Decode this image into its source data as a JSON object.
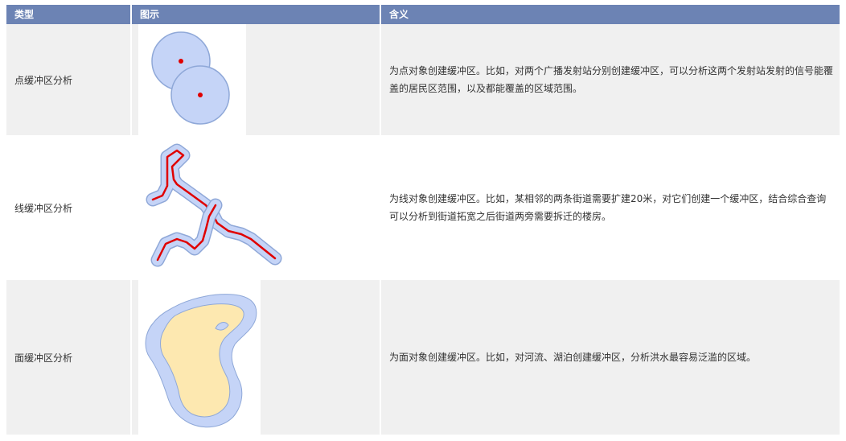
{
  "header": {
    "col_type": "类型",
    "col_figure": "图示",
    "col_meaning": "含义"
  },
  "rows": [
    {
      "type": "点缓冲区分析",
      "meaning": "为点对象创建缓冲区。比如，对两个广播发射站分别创建缓冲区，可以分析这两个发射站发射的信号能覆盖的居民区范围，以及都能覆盖的区域范围。"
    },
    {
      "type": "线缓冲区分析",
      "meaning": "为线对象创建缓冲区。比如，某相邻的两条街道需要扩建20米，对它们创建一个缓冲区，结合综合查询可以分析到街道拓宽之后街道两旁需要拆迁的楼房。"
    },
    {
      "type": "面缓冲区分析",
      "meaning": "为面对象创建缓冲区。比如，对河流、湖泊创建缓冲区，分析洪水最容易泛滥的区域。"
    }
  ],
  "colors": {
    "header_bg": "#6c83b4",
    "buffer_fill": "#c5d4f7",
    "buffer_stroke": "#8fa8d8",
    "feature_red": "#e00000",
    "polygon_fill": "#fde8b0"
  }
}
